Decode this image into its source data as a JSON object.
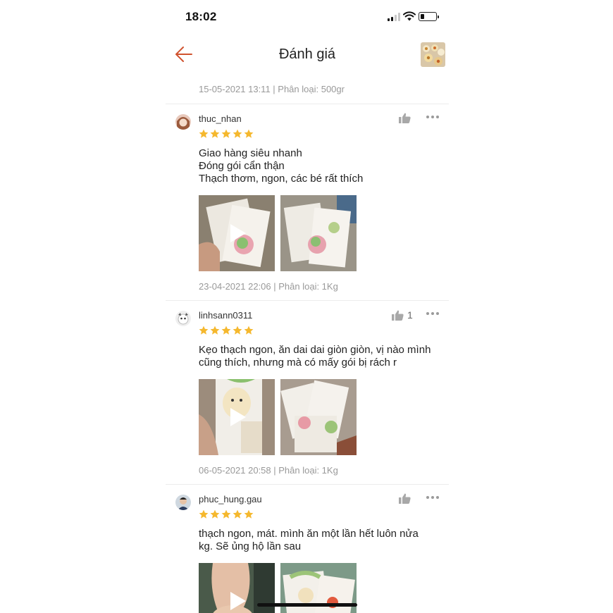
{
  "status_bar": {
    "time": "18:02",
    "battery_level": 0.25
  },
  "header": {
    "title": "Đánh giá",
    "back_icon": "arrow-left-icon",
    "accent": "#d0532f"
  },
  "top_meta": "15-05-2021 13:11 | Phân loại: 500gr",
  "reviews": [
    {
      "username": "thuc_nhan",
      "rating": 5,
      "likes": "",
      "comment_lines": [
        "Giao hàng siêu nhanh",
        "Đóng gói cẩn thận",
        "Thạch thơm, ngon, các bé rất thích"
      ],
      "meta": "23-04-2021 22:06 | Phân loại: 1Kg"
    },
    {
      "username": "linhsann0311",
      "rating": 5,
      "likes": "1",
      "comment_lines": [
        "Kẹo thạch ngon, ăn dai dai giòn giòn, vị nào mình",
        "cũng thích, nhưng mà có mấy gói bị rách r"
      ],
      "meta": "06-05-2021 20:58 | Phân loại: 1Kg"
    },
    {
      "username": "phuc_hung.gau",
      "rating": 5,
      "likes": "",
      "comment_lines": [
        "thạch ngon, mát. mình ăn một lần hết luôn nửa",
        "kg. Sẽ ủng hộ lần sau"
      ],
      "meta": ""
    }
  ],
  "colors": {
    "star": "#f5b82e",
    "meta_text": "#999999",
    "divider": "#ececec"
  }
}
